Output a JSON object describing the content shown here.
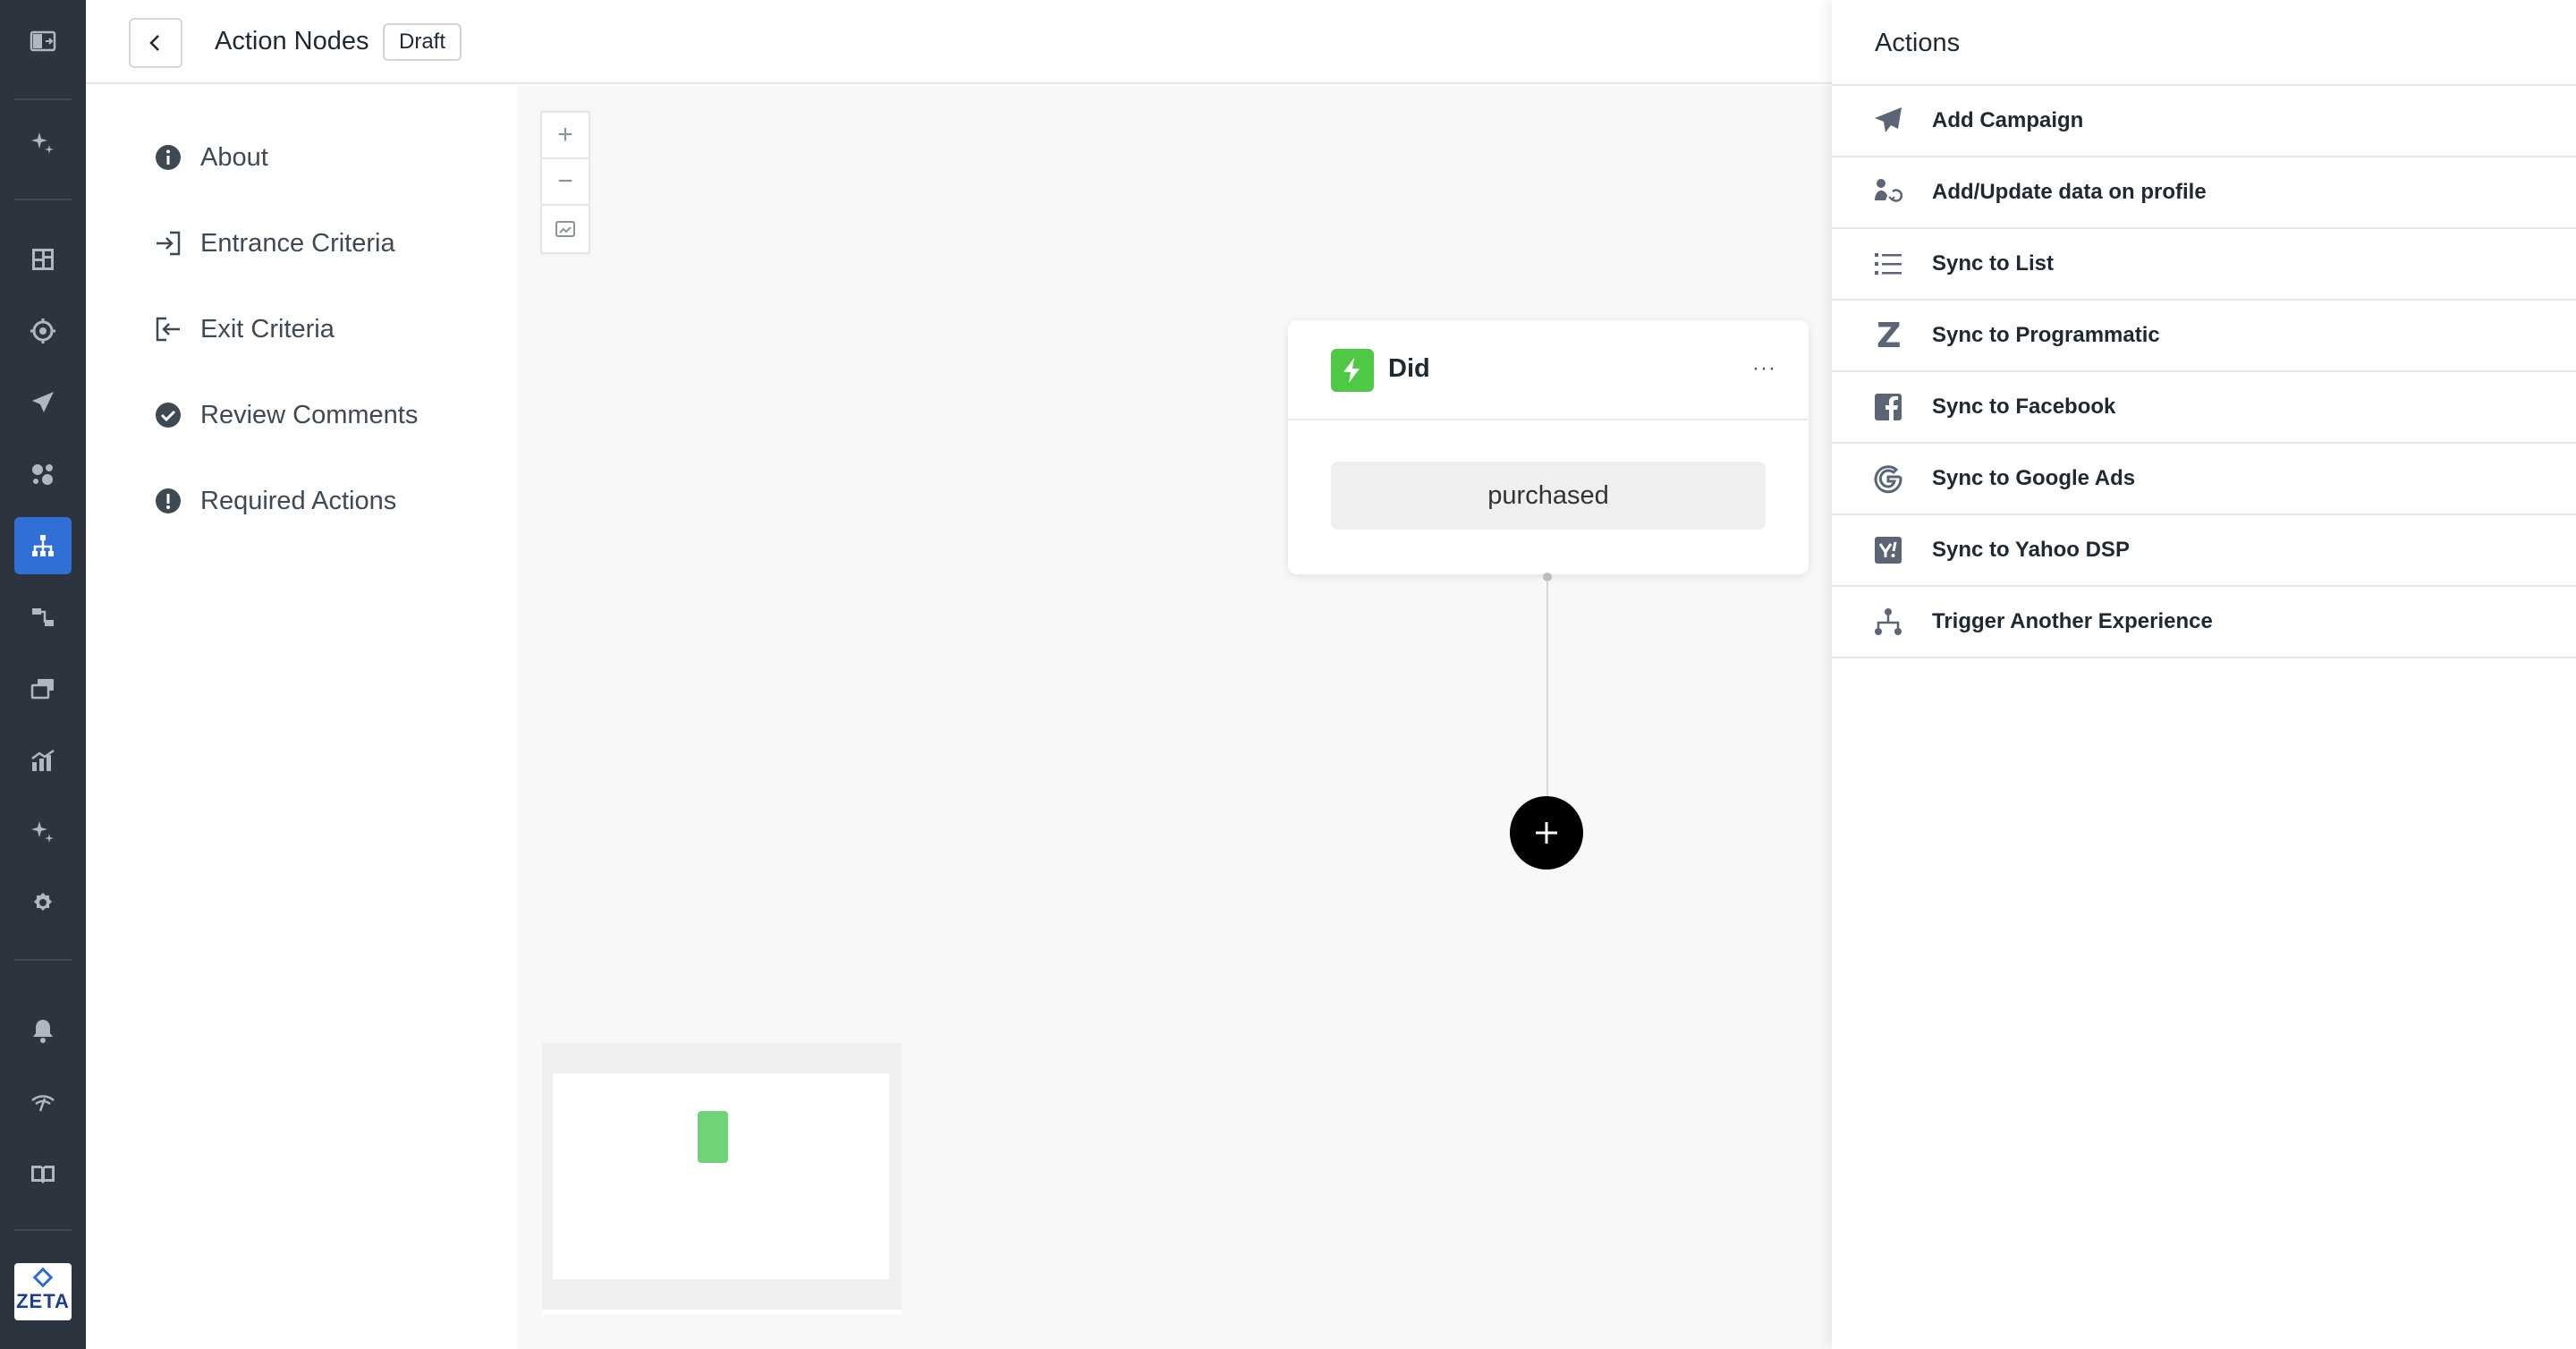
{
  "header": {
    "title": "Action Nodes",
    "status_badge": "Draft"
  },
  "section_nav": {
    "items": [
      {
        "label": "About",
        "icon": "info-icon"
      },
      {
        "label": "Entrance Criteria",
        "icon": "enter-icon"
      },
      {
        "label": "Exit Criteria",
        "icon": "exit-icon"
      },
      {
        "label": "Review Comments",
        "icon": "check-circle-icon"
      },
      {
        "label": "Required Actions",
        "icon": "alert-icon"
      }
    ]
  },
  "canvas": {
    "zoom_in": "+",
    "zoom_out": "−",
    "node": {
      "title": "Did",
      "menu": "···",
      "event": "purchased",
      "icon_color": "#4fc846"
    }
  },
  "actions_panel": {
    "title": "Actions",
    "items": [
      {
        "label": "Add Campaign",
        "icon": "paper-plane-icon"
      },
      {
        "label": "Add/Update data on profile",
        "icon": "profile-sync-icon"
      },
      {
        "label": "Sync to List",
        "icon": "list-icon"
      },
      {
        "label": "Sync to Programmatic",
        "icon": "zeta-z-icon"
      },
      {
        "label": "Sync to Facebook",
        "icon": "facebook-icon"
      },
      {
        "label": "Sync to Google Ads",
        "icon": "google-icon"
      },
      {
        "label": "Sync to Yahoo DSP",
        "icon": "yahoo-icon"
      },
      {
        "label": "Trigger Another Experience",
        "icon": "hierarchy-icon"
      }
    ]
  },
  "rail": {
    "logo_text": "ZETA",
    "active_color": "#2f6fd6"
  }
}
